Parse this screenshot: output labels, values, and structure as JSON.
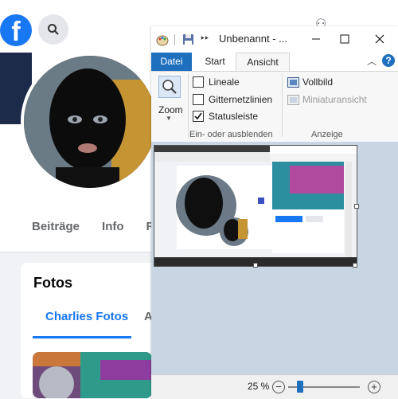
{
  "facebook": {
    "logo_letter": "f",
    "profile_tabs": [
      "Beiträge",
      "Info",
      "F"
    ],
    "photos_title": "Fotos",
    "photos_tab_active": "Charlies Fotos",
    "photos_tab_next": "A"
  },
  "window": {
    "title": "Unbenannt - ...",
    "quick_access_more": "‣‣"
  },
  "ribbon": {
    "tabs": [
      "Datei",
      "Start",
      "Ansicht"
    ],
    "zoom_label": "Zoom",
    "checkboxes": [
      {
        "label": "Lineale",
        "checked": false
      },
      {
        "label": "Gitternetzlinien",
        "checked": false
      },
      {
        "label": "Statusleiste",
        "checked": true
      }
    ],
    "group1_label": "Ein- oder ausblenden",
    "vollbild_label": "Vollbild",
    "miniatur_label": "Miniaturansicht",
    "group2_label": "Anzeige"
  },
  "statusbar": {
    "zoom_value": "25 %",
    "zoom_percent": 25
  },
  "colors": {
    "facebook_blue": "#1877f2",
    "ribbon_file_blue": "#1f6fbf",
    "canvas_bg": "#c8d5e3"
  }
}
